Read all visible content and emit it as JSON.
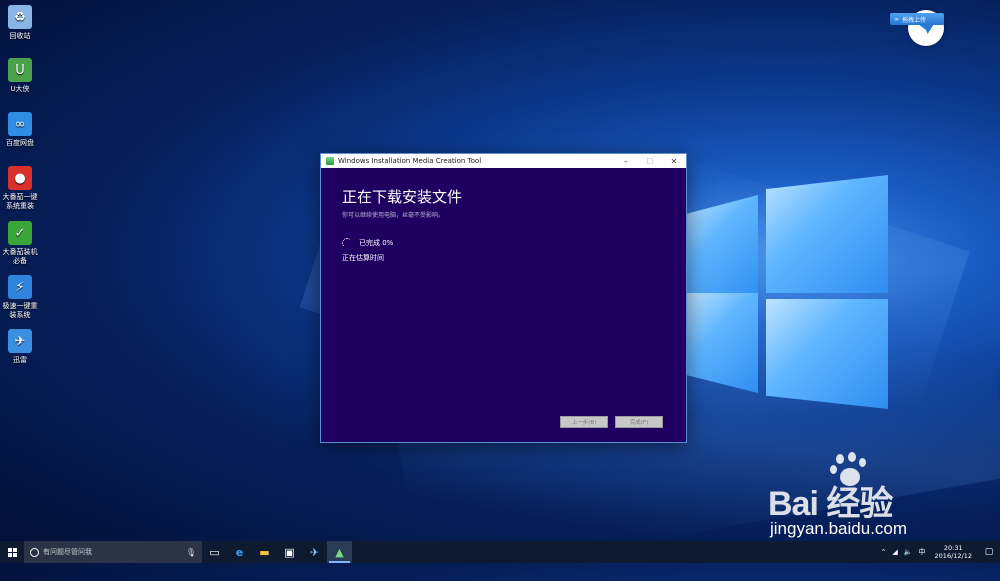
{
  "desktop_icons": [
    {
      "label": "回收站",
      "icon": "recycle-bin-icon",
      "glyph": "♻",
      "color": "#8ab6e6"
    },
    {
      "label": "U大侠",
      "icon": "u-daxia-icon",
      "glyph": "U",
      "color": "#4aa34a"
    },
    {
      "label": "百度网盘",
      "icon": "baidu-netdisk-icon",
      "glyph": "∞",
      "color": "#2f8de4"
    },
    {
      "label": "大番茄一键系统重装",
      "icon": "tomato-reinstall-icon",
      "glyph": "●",
      "color": "#d9302c"
    },
    {
      "label": "大番茄装机必备",
      "icon": "tomato-essentials-icon",
      "glyph": "✓",
      "color": "#3aa63a"
    },
    {
      "label": "极速一键重装系统",
      "icon": "fast-reinstall-icon",
      "glyph": "⚡",
      "color": "#2e84dc"
    },
    {
      "label": "迅雷",
      "icon": "xunlei-icon",
      "glyph": "✈",
      "color": "#3a8fe0"
    }
  ],
  "dialog": {
    "title": "Windows Installation Media Creation Tool",
    "heading": "正在下载安装文件",
    "subtext": "你可以继续使用电脑，丝毫不受影响。",
    "progress_text": "已完成 0%",
    "status_text": "正在估算时间",
    "back_label": "上一步(B)",
    "finish_label": "完成(F)"
  },
  "pan_badge": {
    "label": "拖拽上传"
  },
  "watermark": {
    "main": "Bai  经验",
    "url": "jingyan.baidu.com"
  },
  "taskbar": {
    "search_placeholder": "有问题尽管问我",
    "tray_ime": "中",
    "time": "20:31",
    "date": "2016/12/12"
  }
}
